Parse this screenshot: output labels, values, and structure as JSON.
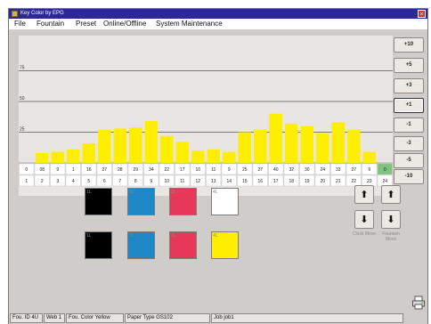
{
  "window": {
    "title": "Key Color by EPG",
    "close_glyph": "×"
  },
  "menu": {
    "items": [
      "File",
      "Fountain",
      "Preset",
      "Online/Offline",
      "System Maintenance"
    ]
  },
  "chart_data": {
    "type": "bar",
    "categories": [
      "1",
      "2",
      "3",
      "4",
      "5",
      "6",
      "7",
      "8",
      "9",
      "10",
      "11",
      "12",
      "13",
      "14",
      "15",
      "16",
      "17",
      "18",
      "19",
      "20",
      "21",
      "22",
      "23",
      "24"
    ],
    "values": [
      0,
      8,
      9,
      11,
      16,
      27,
      28,
      29,
      34,
      22,
      17,
      10,
      11,
      9,
      25,
      27,
      40,
      32,
      30,
      24,
      33,
      27,
      9,
      0
    ],
    "value_labels": [
      "0",
      "08",
      "9",
      "1",
      "16",
      "27",
      "28",
      "29",
      "34",
      "22",
      "17",
      "10",
      "11",
      "9",
      "25",
      "27",
      "40",
      "32",
      "30",
      "24",
      "33",
      "27",
      "9",
      "0"
    ],
    "gridlines": [
      "75",
      "50",
      "25"
    ],
    "ylim": [
      0,
      100
    ],
    "bar_color": "#ffee00",
    "highlight_color": "#7ec47e",
    "highlight_index": 23
  },
  "adjust_buttons": [
    "+10",
    "+5",
    "+3",
    "+1",
    "-1",
    "-3",
    "-5",
    "-10"
  ],
  "selected_adjust": "+1",
  "swatch_rows": [
    [
      {
        "label": "1L",
        "color": "#000000"
      },
      {
        "label": "2L",
        "color": "#1e87c8"
      },
      {
        "label": "3L",
        "color": "#e8385a"
      },
      {
        "label": "4L",
        "color": "#ffffff"
      }
    ],
    [
      {
        "label": "1L",
        "color": "#000000"
      },
      {
        "label": "2L",
        "color": "#1e87c8"
      },
      {
        "label": "3L",
        "color": "#e8385a"
      },
      {
        "label": "4L",
        "color": "#ffee00"
      }
    ]
  ],
  "arrows": {
    "up": "⬆",
    "down": "⬇",
    "clock_move": "Clock Move",
    "fountain_move": "Fountain Move"
  },
  "status": {
    "fountain_id": "Fou. ID 4U",
    "web": "Web 1",
    "fountain_color": "Fou. Color Yellow",
    "paper_type": "Paper Type GS102",
    "job": "Job job1"
  },
  "icons": {
    "window_icon": "app-icon",
    "printer_icon": "printer-icon"
  }
}
